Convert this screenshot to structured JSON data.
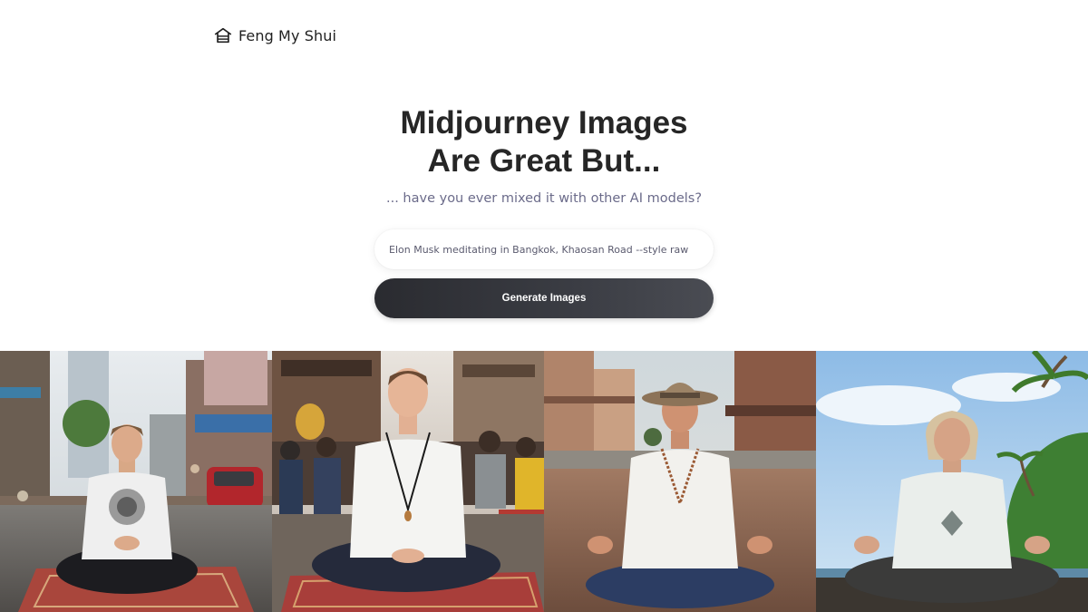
{
  "brand": {
    "name": "Feng My Shui",
    "icon": "home-icon"
  },
  "hero": {
    "title_line1": "Midjourney Images",
    "title_line2": "Are Great But...",
    "subtitle": "... have you ever mixed it with other AI models?"
  },
  "prompt": {
    "value": "Elon Musk meditating in Bangkok, Khaosan Road --style raw"
  },
  "generate_button": {
    "label": "Generate Images"
  },
  "gallery": {
    "count": 4,
    "images": [
      "meditating-man-street-market-image",
      "meditating-man-temple-street-image",
      "meditating-man-cowboy-hat-image",
      "meditating-man-beach-image"
    ]
  },
  "colors": {
    "text": "#262626",
    "subtitle": "#6b6b8a",
    "button_dark": "#2a2b30",
    "background": "#ffffff"
  }
}
